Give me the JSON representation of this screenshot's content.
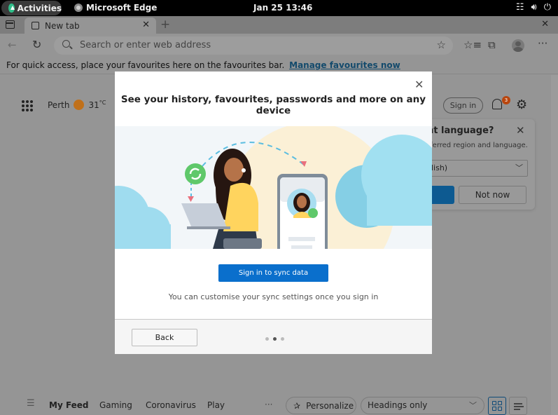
{
  "system_bar": {
    "activities_label": "Activities",
    "app_name": "Microsoft Edge",
    "clock": "Jan 25  13:46",
    "tray_icons": [
      "network-icon",
      "volume-icon",
      "power-icon"
    ]
  },
  "browser": {
    "tabs": [
      {
        "label": "New tab",
        "active": true
      }
    ],
    "address_bar": {
      "placeholder": "Search or enter web address",
      "value": ""
    },
    "favourites_bar": {
      "message": "For quick access, place your favourites here on the favourites bar.",
      "link_label": "Manage favourites now"
    }
  },
  "new_tab_page": {
    "weather": {
      "city": "Perth",
      "temperature": "31",
      "unit": "°C"
    },
    "sign_in_label": "Sign in",
    "notification_count": "3",
    "language_popup": {
      "title": "nt language?",
      "description": "eferred region and language.",
      "selected_language": "glish)",
      "not_now_label": "Not now"
    },
    "feed": {
      "tabs": [
        "My Feed",
        "Gaming",
        "Coronavirus",
        "Play"
      ],
      "active_tab": "My Feed",
      "more_label": "···",
      "personalize_label": "Personalize",
      "layout_option": "Headings only"
    }
  },
  "sync_dialog": {
    "title": "See your history, favourites, passwords and more on any device",
    "primary_button": "Sign in to sync data",
    "note": "You can customise your sync settings once you sign in",
    "back_button": "Back",
    "step_current": 2,
    "step_total": 3
  },
  "colors": {
    "primary_blue": "#0a6fcc",
    "overlay_gray": "#959595",
    "sync_green": "#5fc86a",
    "cloud_blue": "#9fdcef"
  }
}
